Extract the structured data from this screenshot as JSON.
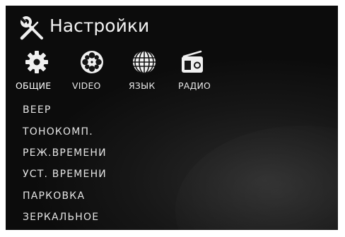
{
  "header": {
    "title": "Настройки",
    "icon": "tools-icon"
  },
  "tabs": [
    {
      "label": "ОБЩИЕ",
      "icon": "gear-icon",
      "active": true
    },
    {
      "label": "VIDEO",
      "icon": "film-reel-icon",
      "active": false
    },
    {
      "label": "ЯЗЫК",
      "icon": "globe-icon",
      "active": false
    },
    {
      "label": "РАДИО",
      "icon": "radio-icon",
      "active": false
    }
  ],
  "menu": {
    "items": [
      {
        "label": "BEEP"
      },
      {
        "label": "ТОНОКОМП."
      },
      {
        "label": "РЕЖ.ВРЕМЕНИ"
      },
      {
        "label": "УСТ. ВРЕМЕНИ"
      },
      {
        "label": "ПАРКОВКА"
      },
      {
        "label": "ЗЕРКАЛЬНОЕ"
      }
    ]
  },
  "colors": {
    "background": "#111111",
    "text": "#e4e4e4",
    "icon": "#f0f0f0"
  }
}
